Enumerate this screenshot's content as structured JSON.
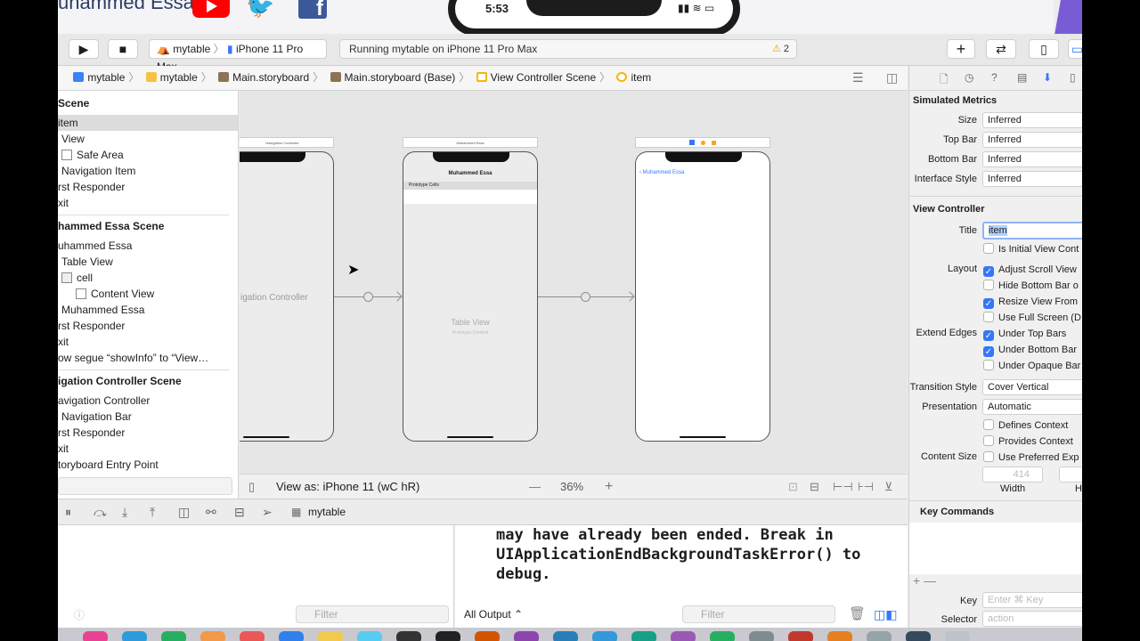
{
  "banner": {
    "channel_name": "uhammed Essa"
  },
  "phone_status": {
    "time": "5:53",
    "signal": "▮▮ ≋ ▭"
  },
  "toolbar": {
    "run_icon": "▶",
    "stop_icon": "■",
    "scheme_project": "mytable",
    "scheme_device": "iPhone 11 Pro Max",
    "status_text": "Running mytable on iPhone 11 Pro Max",
    "warning_count": "2"
  },
  "jumpbar": {
    "items": [
      "mytable",
      "mytable",
      "Main.storyboard",
      "Main.storyboard (Base)",
      "View Controller Scene",
      "item"
    ]
  },
  "outline": {
    "rows": [
      "Scene",
      "item",
      "View",
      "Safe Area",
      "Navigation Item",
      "rst Responder",
      "xit",
      "hammed Essa Scene",
      "uhammed Essa",
      "Table View",
      "cell",
      "Content View",
      "Muhammed Essa",
      "rst Responder",
      "xit",
      "ow segue “showInfo” to “View…",
      "igation Controller Scene",
      "avigation Controller",
      "Navigation Bar",
      "rst Responder",
      "xit",
      "toryboard Entry Point"
    ]
  },
  "canvas": {
    "nav_controller_bar": "Navigation Controller",
    "nav_controller_label": "igation Controller",
    "table_bar": "Muhammed Essa",
    "table_title": "Muhammed Essa",
    "prototype_cells": "Prototype Cells",
    "table_view_label": "Table View",
    "prototype_content": "Prototype Content",
    "back_button": "Muhammed Essa"
  },
  "canvas_bar": {
    "view_as": "View as: iPhone 11 (wC hR)",
    "zoom": "36%",
    "minus": "—",
    "plus": "+"
  },
  "debug_bar": {
    "target": "mytable"
  },
  "console": {
    "text": "may have already been ended. Break in\nUIApplicationEndBackgroundTaskError() to\ndebug.",
    "output_selector": "All Output ⌃",
    "filter_placeholder": "Filter"
  },
  "inspector": {
    "simulated_metrics_title": "Simulated Metrics",
    "metrics": [
      {
        "label": "Size",
        "value": "Inferred"
      },
      {
        "label": "Top Bar",
        "value": "Inferred"
      },
      {
        "label": "Bottom Bar",
        "value": "Inferred"
      },
      {
        "label": "Interface Style",
        "value": "Inferred"
      }
    ],
    "view_controller_title": "View Controller",
    "title_label": "Title",
    "title_value": "item",
    "initial_vc": "Is Initial View Cont",
    "layout_label": "Layout",
    "layout_checks": [
      {
        "label": "Adjust Scroll View",
        "checked": true
      },
      {
        "label": "Hide Bottom Bar o",
        "checked": false
      },
      {
        "label": "Resize View From",
        "checked": true
      },
      {
        "label": "Use Full Screen (D",
        "checked": false
      }
    ],
    "extend_edges_label": "Extend Edges",
    "edge_checks": [
      {
        "label": "Under Top Bars",
        "checked": true
      },
      {
        "label": "Under Bottom Bar",
        "checked": true
      },
      {
        "label": "Under Opaque Bar",
        "checked": false
      }
    ],
    "transition_label": "Transition Style",
    "transition_value": "Cover Vertical",
    "presentation_label": "Presentation",
    "presentation_value": "Automatic",
    "defines_context": "Defines Context",
    "provides_context": "Provides Context",
    "content_size_label": "Content Size",
    "use_preferred": "Use Preferred Exp",
    "width_value": "414",
    "width_label": "Width",
    "height_label": "H",
    "key_commands_title": "Key Commands",
    "key_label": "Key",
    "key_placeholder": "Enter ⌘ Key",
    "selector_label": "Selector",
    "selector_placeholder": "action"
  },
  "colors": {
    "accent": "#3478f6",
    "warning": "#e6a400",
    "youtube": "#ff0000",
    "twitter": "#1da1f2",
    "facebook": "#3b5998"
  }
}
